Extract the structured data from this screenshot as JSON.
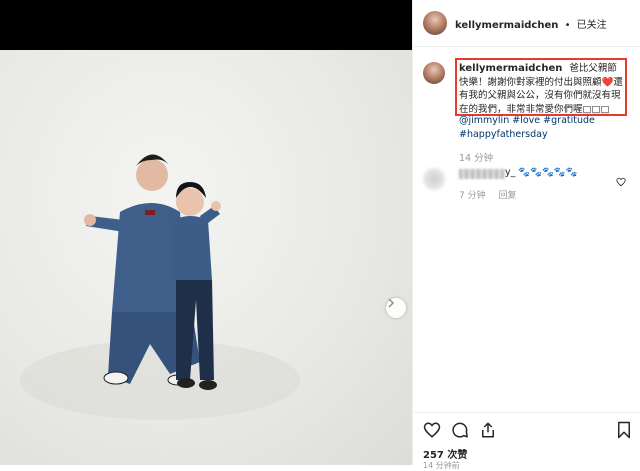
{
  "post": {
    "username": "kellymermaidchen",
    "follow_label": "已关注",
    "separator": "•",
    "caption_user": "kellymermaidchen",
    "caption_text": "爸比父親節快樂！謝謝你對家裡的付出與照顧❤️還有我的父親與公公，沒有你們就沒有現在的我們，非常非常愛你們喔□□□",
    "hashtag_1": "@jimmylin",
    "hashtag_2": "#love",
    "hashtag_3": "#gratitude",
    "hashtag_4": "#happyfathersday",
    "time_ago": "14 分钟",
    "likes_text": "257 次赞",
    "bottom_time": "14 分钟前"
  },
  "comment": {
    "user": "y_",
    "text": "🐾🐾🐾🐾🐾",
    "time": "7 分钟",
    "reply_label": "回复"
  },
  "icons": {
    "next": "chevron-right-icon",
    "like": "heart-icon",
    "comment": "comment-bubble-icon",
    "share": "share-icon",
    "save": "bookmark-icon"
  },
  "colors": {
    "highlight": "#e8392e",
    "hashtag": "#003569",
    "meta": "#999999"
  }
}
